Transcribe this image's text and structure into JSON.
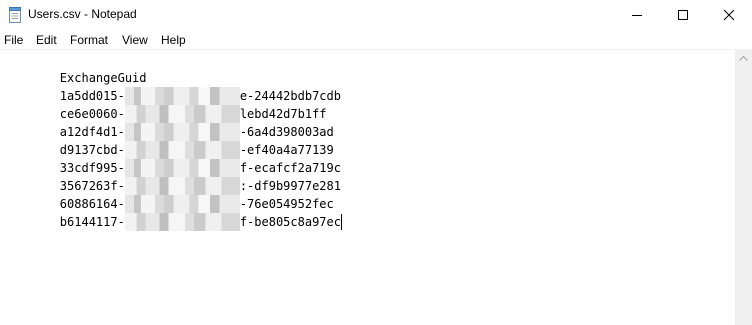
{
  "window": {
    "title": "Users.csv - Notepad"
  },
  "menu": {
    "items": [
      "File",
      "Edit",
      "Format",
      "View",
      "Help"
    ]
  },
  "document": {
    "header": "ExchangeGuid",
    "rows": [
      {
        "prefix": "1a5dd015-",
        "suffix": "e-24442bdb7cdb"
      },
      {
        "prefix": "ce6e0060-",
        "suffix": "lebd42d7b1ff"
      },
      {
        "prefix": "a12df4d1-",
        "suffix": "-6a4d398003ad"
      },
      {
        "prefix": "d9137cbd-",
        "suffix": "-ef40a4a77139"
      },
      {
        "prefix": "33cdf995-",
        "suffix": "f-ecafcf2a719c"
      },
      {
        "prefix": "3567263f-",
        "suffix": ":-df9b9977e281"
      },
      {
        "prefix": "60886164-",
        "suffix": "-76e054952fec"
      },
      {
        "prefix": "b6144117-",
        "suffix": "f-be805c8a97ec"
      }
    ]
  },
  "icons": {
    "app": "notepad-icon",
    "minimize": "minimize-icon",
    "maximize": "maximize-icon",
    "close": "close-icon",
    "scroll_up": "scroll-up-arrow-icon"
  }
}
